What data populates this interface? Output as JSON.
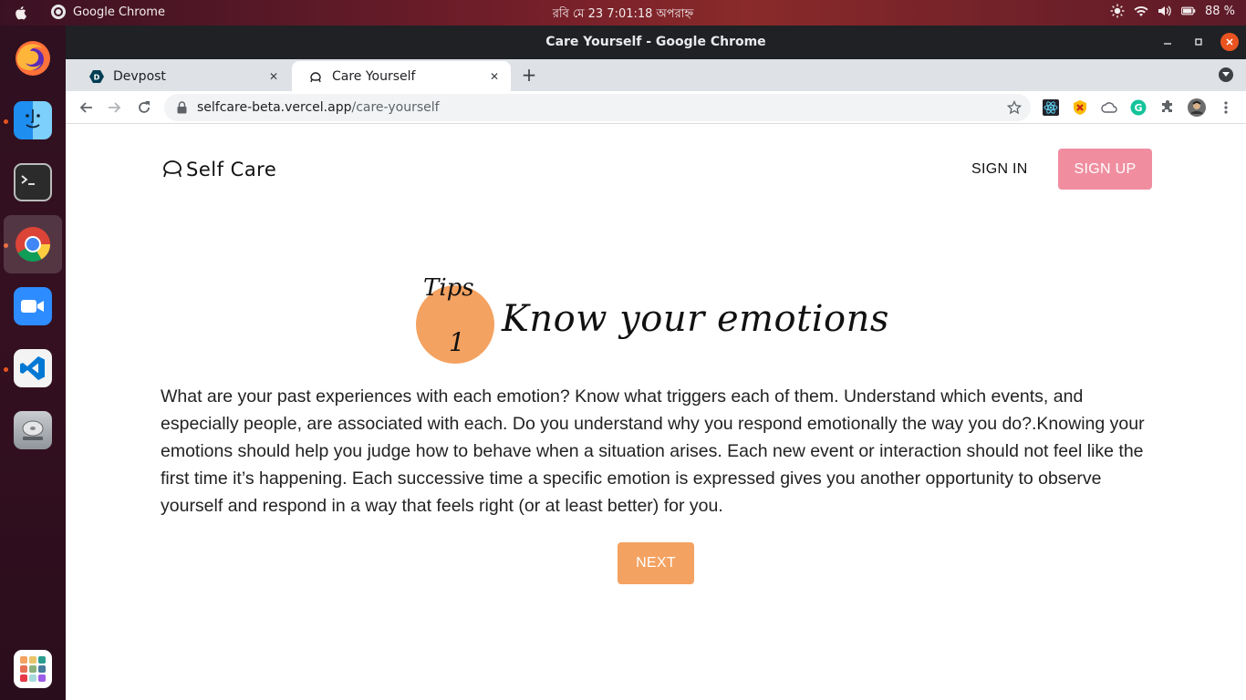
{
  "topbar": {
    "app_name": "Google Chrome",
    "clock": "রবি মে 23   7:01:18 অপরাহ্ন",
    "battery": "88 %"
  },
  "window": {
    "title": "Care Yourself - Google Chrome"
  },
  "tabs": [
    {
      "label": "Devpost",
      "icon": "devpost-icon"
    },
    {
      "label": "Care Yourself",
      "icon": "selfcare-icon",
      "active": true
    }
  ],
  "address": {
    "host": "selfcare-beta.vercel.app",
    "path": "/care-yourself"
  },
  "site": {
    "logo": "Self Care",
    "signin": "SIGN IN",
    "signup": "SIGN UP",
    "accent": "#f4a261",
    "signup_color": "#f08ea0"
  },
  "tip": {
    "badge": "Tips",
    "number": "1",
    "title": "Know your emotions",
    "body": "What are your past experiences with each emotion? Know what triggers each of them. Understand which events, and especially people, are associated with each. Do you understand why you respond emotionally the way you do?.Knowing your emotions should help you judge how to behave when a situation arises. Each new event or interaction should not feel like the first time it’s happening. Each successive time a specific emotion is expressed gives you another opportunity to observe yourself and respond in a way that feels right (or at least better) for you.",
    "next": "NEXT"
  },
  "dock": [
    "firefox-icon",
    "finder-icon",
    "terminal-icon",
    "chrome-icon",
    "zoom-icon",
    "vscode-icon",
    "disk-icon",
    "app-grid-icon"
  ]
}
